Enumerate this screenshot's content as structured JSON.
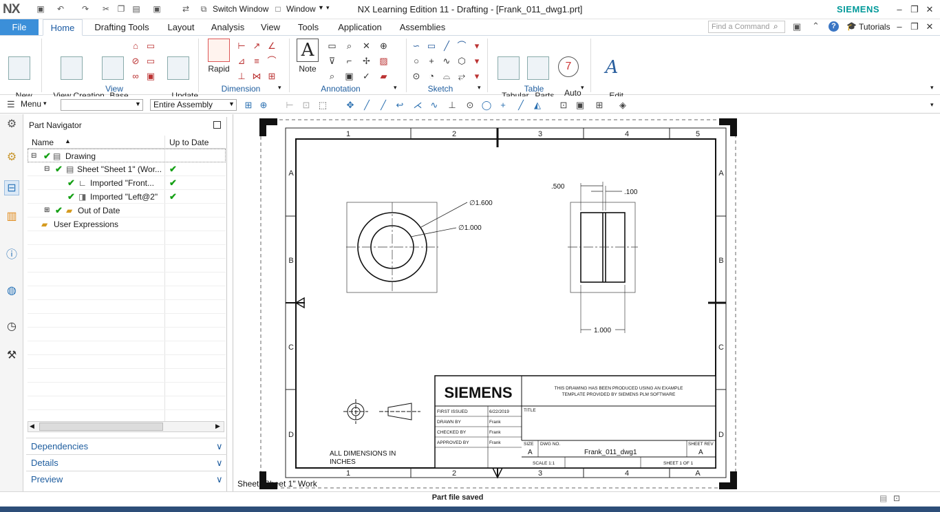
{
  "titlebar": {
    "logo": "NX",
    "title": "NX Learning Edition 11 - Drafting - [Frank_011_dwg1.prt]",
    "brand": "SIEMENS",
    "switch_window": "Switch Window",
    "window_menu": "Window"
  },
  "ribbon_tabs": [
    "File",
    "Home",
    "Drafting Tools",
    "Layout",
    "Analysis",
    "View",
    "Tools",
    "Application",
    "Assemblies"
  ],
  "find_command": {
    "placeholder": "Find a Command"
  },
  "tutorials": "Tutorials",
  "ribbon": {
    "new_sheet": "New\nSheet",
    "view_creation_wizard": "View Creation\nWizard",
    "base_view": "Base\nView",
    "update_views": "Update\nViews",
    "rapid": "Rapid",
    "note": "Note",
    "tabular_note": "Tabular\nNote",
    "parts_list": "Parts\nList",
    "auto_balloon": "Auto\nBalloon",
    "edit_settings": "Edit\nSettings",
    "groups": {
      "view": "View",
      "dimension": "Dimension",
      "annotation": "Annotation",
      "sketch": "Sketch",
      "table": "Table"
    }
  },
  "toolbar": {
    "menu": "Menu",
    "filter_value": "",
    "assembly_scope": "Entire Assembly"
  },
  "navigator": {
    "title": "Part Navigator",
    "col_name": "Name",
    "col_uptodate": "Up to Date",
    "rows": [
      {
        "label": "Drawing"
      },
      {
        "label": "Sheet \"Sheet 1\" (Wor..."
      },
      {
        "label": "Imported \"Front..."
      },
      {
        "label": "Imported \"Left@2\""
      },
      {
        "label": "Out of Date"
      },
      {
        "label": "User Expressions"
      }
    ],
    "sections": [
      "Dependencies",
      "Details",
      "Preview"
    ]
  },
  "drawing": {
    "cols_top": [
      "1",
      "2",
      "3",
      "4",
      "5"
    ],
    "cols_bottom": [
      "1",
      "2",
      "3",
      "4",
      "A"
    ],
    "rows": [
      "A",
      "B",
      "C",
      "D"
    ],
    "dims": {
      "outer_dia": "∅1.600",
      "inner_dia": "∅1.000",
      "dim_500": ".500",
      "dim_100": ".100",
      "dim_1000": "1.000"
    },
    "note": "ALL DIMENSIONS IN\nINCHES",
    "title_block": {
      "logo": "SIEMENS",
      "notice_1": "THIS DRAWING HAS BEEN PRODUCED USING AN EXAMPLE",
      "notice_2": "TEMPLATE PROVIDED BY SIEMENS PLM SOFTWARE",
      "first_issued_label": "FIRST ISSUED",
      "first_issued": "6/22/2019",
      "drawn_by_label": "DRAWN BY",
      "drawn_by": "Frank",
      "checked_by_label": "CHECKED BY",
      "checked_by": "Frank",
      "approved_by_label": "APPROVED BY",
      "approved_by": "Frank",
      "title_label": "TITLE",
      "size_label": "SIZE",
      "size": "A",
      "dwg_no_label": "DWG NO.",
      "dwg_no": "Frank_011_dwg1",
      "sheet_rev_label": "SHEET REV",
      "sheet_rev": "A",
      "scale": "SCALE 1:1",
      "sheet": "SHEET 1 OF 1"
    },
    "sheet_label": "Sheet \"Sheet 1\" Work"
  },
  "status": "Part file saved"
}
